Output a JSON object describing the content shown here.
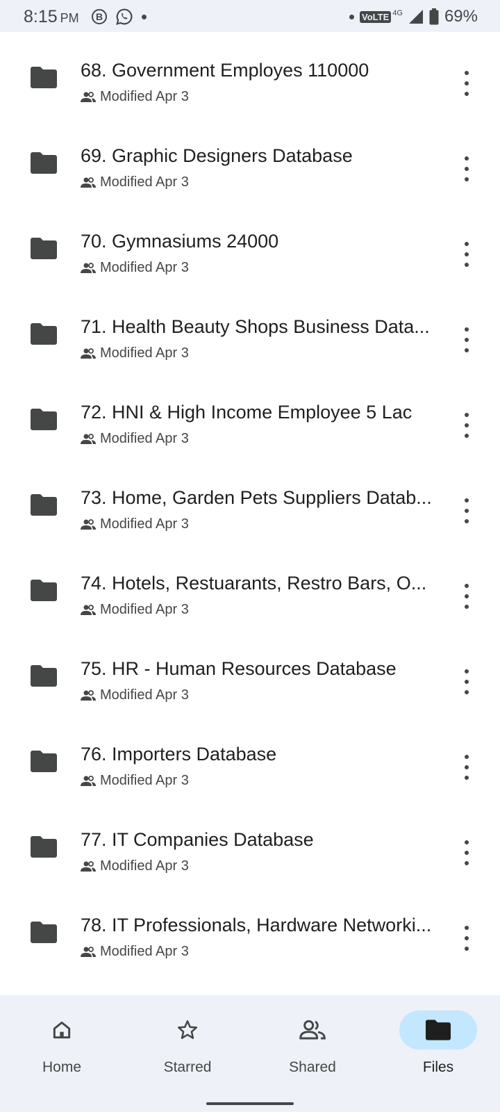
{
  "status_bar": {
    "time": "8:15",
    "ampm": "PM",
    "volte": "VoLTE",
    "network": "4G",
    "battery": "69%"
  },
  "files": [
    {
      "title": "68. Government Employes 110000",
      "modified": "Modified Apr 3"
    },
    {
      "title": "69. Graphic Designers Database",
      "modified": "Modified Apr 3"
    },
    {
      "title": "70. Gymnasiums 24000",
      "modified": "Modified Apr 3"
    },
    {
      "title": "71. Health Beauty Shops Business Data...",
      "modified": "Modified Apr 3"
    },
    {
      "title": "72. HNI & High Income Employee 5 Lac",
      "modified": "Modified Apr 3"
    },
    {
      "title": "73. Home, Garden Pets Suppliers Datab...",
      "modified": "Modified Apr 3"
    },
    {
      "title": "74. Hotels, Restuarants, Restro Bars, O...",
      "modified": "Modified Apr 3"
    },
    {
      "title": "75. HR - Human Resources Database",
      "modified": "Modified Apr 3"
    },
    {
      "title": "76. Importers Database",
      "modified": "Modified Apr 3"
    },
    {
      "title": "77. IT Companies Database",
      "modified": "Modified Apr 3"
    },
    {
      "title": "78. IT Professionals, Hardware Networki...",
      "modified": "Modified Apr 3"
    }
  ],
  "bottom_nav": [
    {
      "label": "Home",
      "icon": "home-icon",
      "active": false
    },
    {
      "label": "Starred",
      "icon": "star-icon",
      "active": false
    },
    {
      "label": "Shared",
      "icon": "people-icon",
      "active": false
    },
    {
      "label": "Files",
      "icon": "folder-icon",
      "active": true
    }
  ],
  "colors": {
    "bar_background": "#eef1f8",
    "active_pill": "#c2e7ff",
    "icon": "#444746"
  }
}
